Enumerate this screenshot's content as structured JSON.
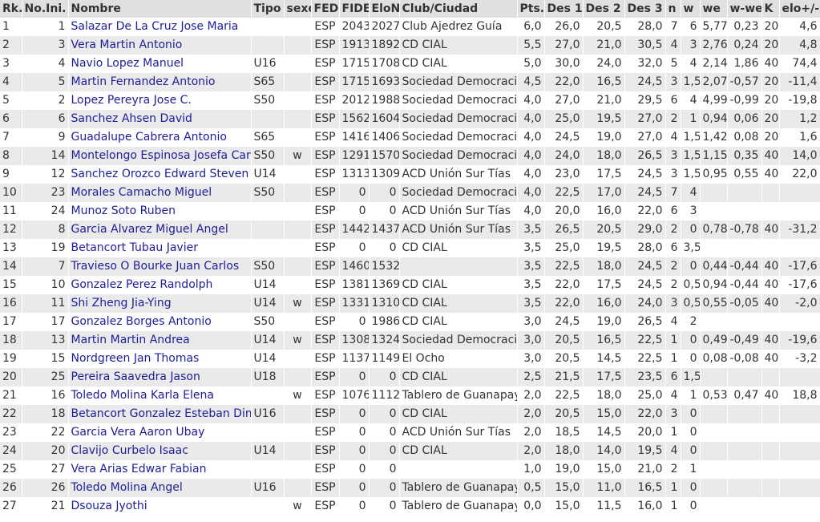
{
  "columns": [
    "Rk.",
    "No.Ini.",
    "Nombre",
    "Tipo",
    "sexo",
    "FED",
    "FIDE",
    "EloN",
    "Club/Ciudad",
    "Pts.",
    "Des 1",
    "Des 2",
    "Des 3",
    "n",
    "w",
    "we",
    "w-we",
    "K",
    "elo+/-"
  ],
  "rows": [
    [
      "1",
      "1",
      "Salazar De La Cruz Jose Maria",
      "",
      "",
      "ESP",
      "2043",
      "2027",
      "Club Ajedrez Guía",
      "6,0",
      "26,0",
      "20,5",
      "28,0",
      "7",
      "6",
      "5,77",
      "0,23",
      "20",
      "4,6"
    ],
    [
      "2",
      "3",
      "Vera Martin Antonio",
      "",
      "",
      "ESP",
      "1913",
      "1892",
      "CD CIAL",
      "5,5",
      "27,0",
      "21,0",
      "30,5",
      "4",
      "3",
      "2,76",
      "0,24",
      "20",
      "4,8"
    ],
    [
      "3",
      "4",
      "Navio Lopez Manuel",
      "U16",
      "",
      "ESP",
      "1715",
      "1708",
      "CD CIAL",
      "5,0",
      "30,0",
      "24,0",
      "32,0",
      "5",
      "4",
      "2,14",
      "1,86",
      "40",
      "74,4"
    ],
    [
      "4",
      "5",
      "Martin Fernandez Antonio",
      "S65",
      "",
      "ESP",
      "1715",
      "1693",
      "Sociedad Democracia",
      "4,5",
      "22,0",
      "16,5",
      "24,5",
      "3",
      "1,5",
      "2,07",
      "-0,57",
      "20",
      "-11,4"
    ],
    [
      "5",
      "2",
      "Lopez Pereyra Jose C.",
      "S50",
      "",
      "ESP",
      "2012",
      "1988",
      "Sociedad Democracia",
      "4,0",
      "27,0",
      "21,0",
      "29,5",
      "6",
      "4",
      "4,99",
      "-0,99",
      "20",
      "-19,8"
    ],
    [
      "6",
      "6",
      "Sanchez Ahsen David",
      "",
      "",
      "ESP",
      "1562",
      "1604",
      "Sociedad Democracia",
      "4,0",
      "25,0",
      "19,5",
      "27,0",
      "2",
      "1",
      "0,94",
      "0,06",
      "20",
      "1,2"
    ],
    [
      "7",
      "9",
      "Guadalupe Cabrera Antonio",
      "S65",
      "",
      "ESP",
      "1416",
      "1406",
      "Sociedad Democracia",
      "4,0",
      "24,5",
      "19,0",
      "27,0",
      "4",
      "1,5",
      "1,42",
      "0,08",
      "20",
      "1,6"
    ],
    [
      "8",
      "14",
      "Montelongo Espinosa Josefa Carm",
      "S50",
      "w",
      "ESP",
      "1291",
      "1570",
      "Sociedad Democracia",
      "4,0",
      "24,0",
      "18,0",
      "26,5",
      "3",
      "1,5",
      "1,15",
      "0,35",
      "40",
      "14,0"
    ],
    [
      "9",
      "12",
      "Sanchez Orozco Edward Steven",
      "U14",
      "",
      "ESP",
      "1313",
      "1309",
      "ACD Unión Sur Tías",
      "4,0",
      "23,0",
      "17,5",
      "24,5",
      "3",
      "1,5",
      "0,95",
      "0,55",
      "40",
      "22,0"
    ],
    [
      "10",
      "23",
      "Morales Camacho Miguel",
      "S50",
      "",
      "ESP",
      "0",
      "0",
      "Sociedad Democracia",
      "4,0",
      "22,5",
      "17,0",
      "24,5",
      "7",
      "4",
      "",
      "",
      "",
      ""
    ],
    [
      "11",
      "24",
      "Munoz Soto Ruben",
      "",
      "",
      "ESP",
      "0",
      "0",
      "ACD Unión Sur Tías",
      "4,0",
      "20,0",
      "16,0",
      "22,0",
      "6",
      "3",
      "",
      "",
      "",
      ""
    ],
    [
      "12",
      "8",
      "Garcia Alvarez Miguel Angel",
      "",
      "",
      "ESP",
      "1442",
      "1437",
      "ACD Unión Sur Tías",
      "3,5",
      "26,5",
      "20,5",
      "29,0",
      "2",
      "0",
      "0,78",
      "-0,78",
      "40",
      "-31,2"
    ],
    [
      "13",
      "19",
      "Betancort Tubau Javier",
      "",
      "",
      "ESP",
      "0",
      "0",
      "CD CIAL",
      "3,5",
      "25,0",
      "19,5",
      "28,0",
      "6",
      "3,5",
      "",
      "",
      "",
      ""
    ],
    [
      "14",
      "7",
      "Travieso O Bourke Juan Carlos",
      "S50",
      "",
      "ESP",
      "1460",
      "1532",
      "",
      "3,5",
      "22,5",
      "18,0",
      "24,5",
      "2",
      "0",
      "0,44",
      "-0,44",
      "40",
      "-17,6"
    ],
    [
      "15",
      "10",
      "Gonzalez Perez Randolph",
      "U14",
      "",
      "ESP",
      "1381",
      "1369",
      "CD CIAL",
      "3,5",
      "22,0",
      "17,5",
      "24,5",
      "2",
      "0,5",
      "0,94",
      "-0,44",
      "40",
      "-17,6"
    ],
    [
      "16",
      "11",
      "Shi Zheng Jia-Ying",
      "U14",
      "w",
      "ESP",
      "1331",
      "1310",
      "CD CIAL",
      "3,5",
      "22,0",
      "16,0",
      "24,0",
      "3",
      "0,5",
      "0,55",
      "-0,05",
      "40",
      "-2,0"
    ],
    [
      "17",
      "17",
      "Gonzalez Borges Antonio",
      "S50",
      "",
      "ESP",
      "0",
      "1986",
      "CD CIAL",
      "3,0",
      "24,5",
      "19,0",
      "26,5",
      "4",
      "2",
      "",
      "",
      "",
      ""
    ],
    [
      "18",
      "13",
      "Martin Martin Andrea",
      "U14",
      "w",
      "ESP",
      "1308",
      "1324",
      "Sociedad Democracia",
      "3,0",
      "20,5",
      "16,5",
      "22,5",
      "1",
      "0",
      "0,49",
      "-0,49",
      "40",
      "-19,6"
    ],
    [
      "19",
      "15",
      "Nordgreen Jan Thomas",
      "U14",
      "",
      "ESP",
      "1137",
      "1149",
      "El Ocho",
      "3,0",
      "20,5",
      "14,5",
      "22,5",
      "1",
      "0",
      "0,08",
      "-0,08",
      "40",
      "-3,2"
    ],
    [
      "20",
      "25",
      "Pereira Saavedra Jason",
      "U18",
      "",
      "ESP",
      "0",
      "0",
      "CD CIAL",
      "2,5",
      "21,5",
      "17,5",
      "23,5",
      "6",
      "1,5",
      "",
      "",
      "",
      ""
    ],
    [
      "21",
      "16",
      "Toledo Molina Karla Elena",
      "",
      "w",
      "ESP",
      "1076",
      "1112",
      "Tablero de Guanapay",
      "2,0",
      "22,5",
      "18,0",
      "25,0",
      "4",
      "1",
      "0,53",
      "0,47",
      "40",
      "18,8"
    ],
    [
      "22",
      "18",
      "Betancort Gonzalez Esteban Dimi",
      "U16",
      "",
      "ESP",
      "0",
      "0",
      "CD CIAL",
      "2,0",
      "20,5",
      "15,0",
      "22,0",
      "3",
      "0",
      "",
      "",
      "",
      ""
    ],
    [
      "23",
      "22",
      "Garcia Vera Aaron Ubay",
      "",
      "",
      "ESP",
      "0",
      "0",
      "ACD Unión Sur Tías",
      "2,0",
      "18,5",
      "14,5",
      "20,0",
      "1",
      "0",
      "",
      "",
      "",
      ""
    ],
    [
      "24",
      "20",
      "Clavijo Curbelo Isaac",
      "U14",
      "",
      "ESP",
      "0",
      "0",
      "CD CIAL",
      "2,0",
      "18,0",
      "14,0",
      "19,5",
      "4",
      "0",
      "",
      "",
      "",
      ""
    ],
    [
      "25",
      "27",
      "Vera Arias Edwar Fabian",
      "",
      "",
      "ESP",
      "0",
      "0",
      "",
      "1,0",
      "19,0",
      "15,0",
      "21,0",
      "2",
      "1",
      "",
      "",
      "",
      ""
    ],
    [
      "26",
      "26",
      "Toledo Molina Angel",
      "U16",
      "",
      "ESP",
      "0",
      "0",
      "Tablero de Guanapay",
      "0,5",
      "15,0",
      "11,0",
      "16,5",
      "1",
      "0",
      "",
      "",
      "",
      ""
    ],
    [
      "27",
      "21",
      "Dsouza Jyothi",
      "",
      "w",
      "ESP",
      "0",
      "0",
      "Tablero de Guanapay",
      "0,0",
      "15,0",
      "11,5",
      "16,0",
      "1",
      "0",
      "",
      "",
      "",
      ""
    ]
  ]
}
